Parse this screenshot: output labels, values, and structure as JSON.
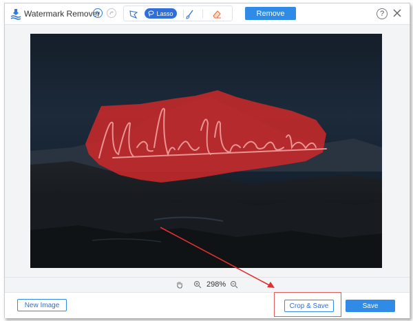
{
  "app": {
    "title": "Watermark Remover"
  },
  "toolbar": {
    "lasso_label": "Lasso",
    "remove_label": "Remove",
    "help_label": "?"
  },
  "canvas": {
    "watermark_text": "Madelyn Hamilton"
  },
  "zoom": {
    "value": "298%"
  },
  "footer": {
    "new_image_label": "New Image",
    "crop_save_label": "Crop & Save",
    "save_label": "Save"
  },
  "icons": {
    "app_logo": "watermark-logo-icon",
    "undo": "undo-icon",
    "redo": "redo-icon",
    "polygon": "polygon-lasso-icon",
    "lasso": "lasso-icon",
    "brush": "brush-icon",
    "eraser": "eraser-icon",
    "help": "help-icon",
    "close": "close-icon",
    "hand": "hand-icon",
    "zoom_in": "zoom-in-icon",
    "zoom_out": "zoom-out-icon"
  },
  "colors": {
    "accent": "#2f8be6",
    "selection_mask": "#d42a2a",
    "annotation": "#e03030"
  }
}
